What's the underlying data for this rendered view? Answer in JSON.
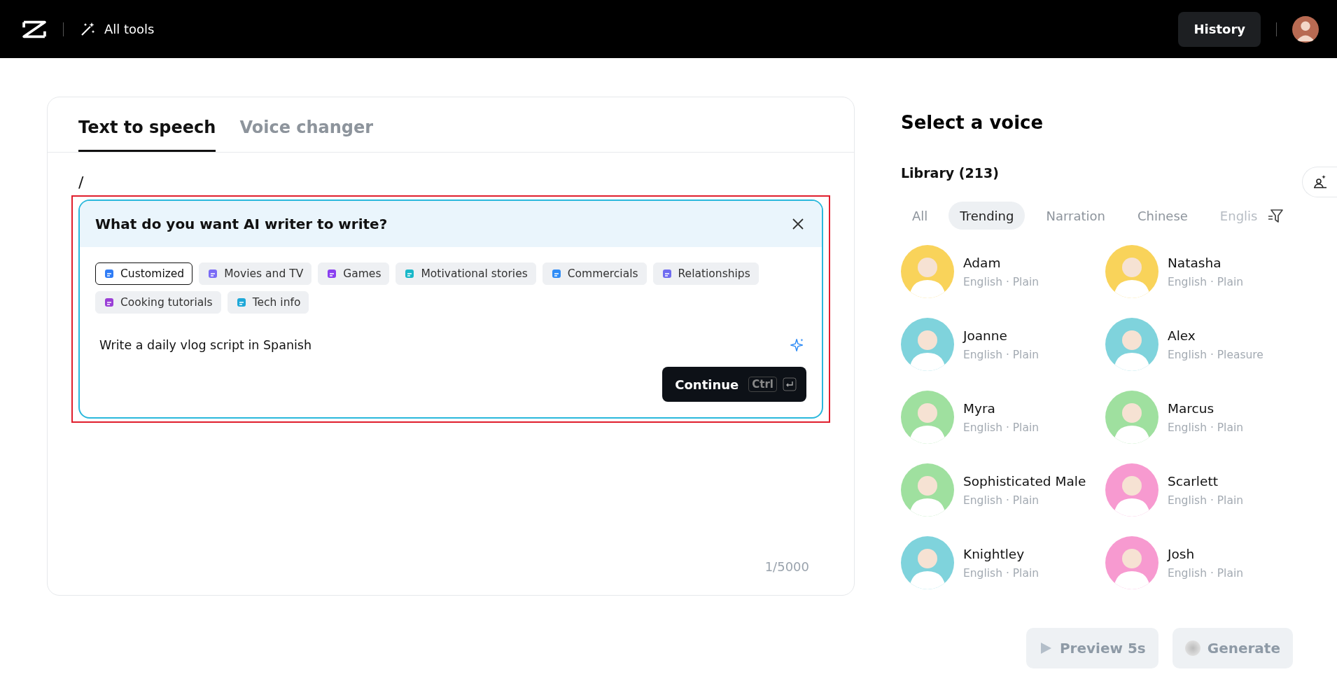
{
  "header": {
    "nav_label": "All tools",
    "history_button": "History"
  },
  "editor": {
    "tabs": [
      {
        "label": "Text to speech",
        "selected": true
      },
      {
        "label": "Voice changer",
        "selected": false
      }
    ],
    "slash": "/",
    "ai_writer": {
      "title": "What do you want AI writer to write?",
      "chips": [
        {
          "label": "Customized",
          "selected": true
        },
        {
          "label": "Movies and TV",
          "selected": false
        },
        {
          "label": "Games",
          "selected": false
        },
        {
          "label": "Motivational stories",
          "selected": false
        },
        {
          "label": "Commercials",
          "selected": false
        },
        {
          "label": "Relationships",
          "selected": false
        },
        {
          "label": "Cooking tutorials",
          "selected": false
        },
        {
          "label": "Tech info",
          "selected": false
        }
      ],
      "prompt": "Write a daily vlog script in Spanish",
      "continue_button": "Continue",
      "shortcut": "Ctrl"
    },
    "counter": "1/5000"
  },
  "voices": {
    "title": "Select a voice",
    "library": "Library (213)",
    "filters": [
      {
        "label": "All",
        "selected": false
      },
      {
        "label": "Trending",
        "selected": true
      },
      {
        "label": "Narration",
        "selected": false
      },
      {
        "label": "Chinese",
        "selected": false
      },
      {
        "label": "Englis",
        "selected": false
      }
    ],
    "items": [
      {
        "name": "Adam",
        "details": "English · Plain",
        "color": "#f9d35a"
      },
      {
        "name": "Natasha",
        "details": "English · Plain",
        "color": "#f9d35a"
      },
      {
        "name": "Joanne",
        "details": "English · Plain",
        "color": "#7fd3dc"
      },
      {
        "name": "Alex",
        "details": "English · Pleasure",
        "color": "#7fd3dc"
      },
      {
        "name": "Myra",
        "details": "English · Plain",
        "color": "#9fe09f"
      },
      {
        "name": "Marcus",
        "details": "English · Plain",
        "color": "#9fe09f"
      },
      {
        "name": "Sophisticated Male",
        "details": "English · Plain",
        "color": "#9fe09f"
      },
      {
        "name": "Scarlett",
        "details": "English · Plain",
        "color": "#f79ad0"
      },
      {
        "name": "Knightley",
        "details": "English · Plain",
        "color": "#7fd3dc"
      },
      {
        "name": "Josh",
        "details": "English · Plain",
        "color": "#f79ad0"
      }
    ]
  },
  "actions": [
    {
      "label": "Preview 5s",
      "kind": "preview",
      "disabled": true
    },
    {
      "label": "Generate",
      "kind": "generate",
      "disabled": true
    }
  ]
}
